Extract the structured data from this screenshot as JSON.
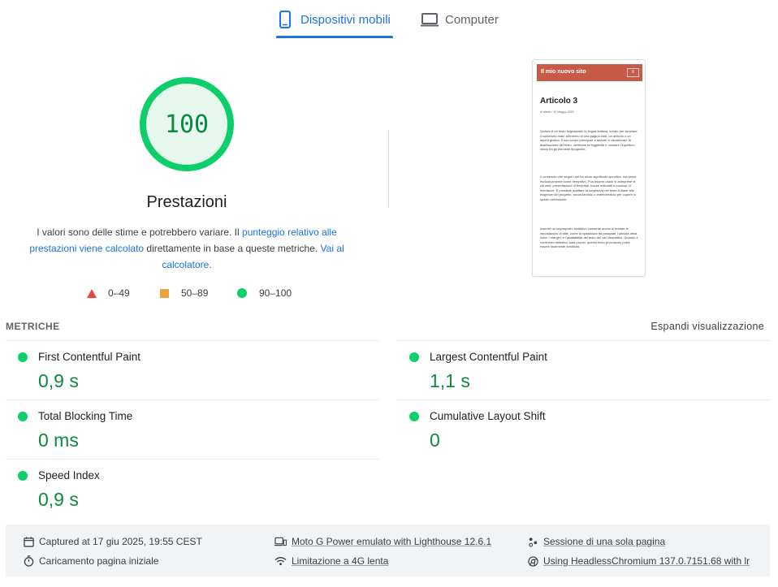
{
  "tabs": [
    {
      "label": "Dispositivi mobili",
      "icon": "smartphone-icon",
      "active": true
    },
    {
      "label": "Computer",
      "icon": "monitor-icon",
      "active": false
    }
  ],
  "score": {
    "value": "100",
    "fraction": 1.0,
    "title": "Prestazioni",
    "color": "#0cce6b"
  },
  "description": {
    "text1": "I valori sono delle stime e potrebbero variare. Il ",
    "link1": "punteggio relativo alle prestazioni viene calcolato",
    "text2": " direttamente in base a queste metriche. ",
    "link2": "Vai al calcolatore."
  },
  "legend": [
    {
      "range": "0–49",
      "color": "#e8453c"
    },
    {
      "range": "50–89",
      "color": "#e8a33d"
    },
    {
      "range": "90–100",
      "color": "#0cce6b"
    }
  ],
  "preview": {
    "site_title": "Il mio nuovo sito",
    "menu": "≡",
    "post_title": "Articolo 3",
    "post_meta": "di utente / 10 Maggio 2025",
    "paragraphs": [
      "Questo è un testo segnaposto in lingua italiana, creato per simulare il contenuto reale all'interno di una pagina web, un articolo o un layout grafico. Il suo scopo principale è aiutare a visualizzare la distribuzione del testo, verificare la leggibilità e valutare l'equilibrio visivo tra gli elementi tipografici.",
      "Il contenuto che segue non ha alcun significato specifico, ma serve esclusivamente come riempitivo. Può essere usato in anteprime di siti web, presentazioni di template, bozze editoriali o mockup di interfacce. È possibile adattare la lunghezza del testo in base alle esigenze del progetto, accorciandolo o estendendolo per coprire lo spazio necessario.",
      "Inserire un segnaposto realistico consente anche di testare le impostazioni di stile, come la spaziatura tra paragrafi, l'altezza della linea, i margini, e l'adattabilità del testo nei vari dispositivi. Quando il contenuto definitivo sarà pronto, questo testo provvisorio potrà essere facilmente sostituito."
    ]
  },
  "metrics": {
    "heading": "METRICHE",
    "expand_label": "Espandi visualizzazione",
    "items": [
      {
        "label": "First Contentful Paint",
        "value": "0,9 s",
        "status": "pass"
      },
      {
        "label": "Largest Contentful Paint",
        "value": "1,1 s",
        "status": "pass"
      },
      {
        "label": "Total Blocking Time",
        "value": "0 ms",
        "status": "pass"
      },
      {
        "label": "Cumulative Layout Shift",
        "value": "0",
        "status": "pass"
      },
      {
        "label": "Speed Index",
        "value": "0,9 s",
        "status": "pass"
      }
    ]
  },
  "footer": {
    "captured": "Captured at 17 giu 2025, 19:55 CEST",
    "load": "Caricamento pagina iniziale",
    "device": "Moto G Power emulato with Lighthouse 12.6.1",
    "throttling": "Limitazione a 4G lenta",
    "session": "Sessione di una sola pagina",
    "browser": "Using HeadlessChromium 137.0.7151.68 with lr"
  }
}
